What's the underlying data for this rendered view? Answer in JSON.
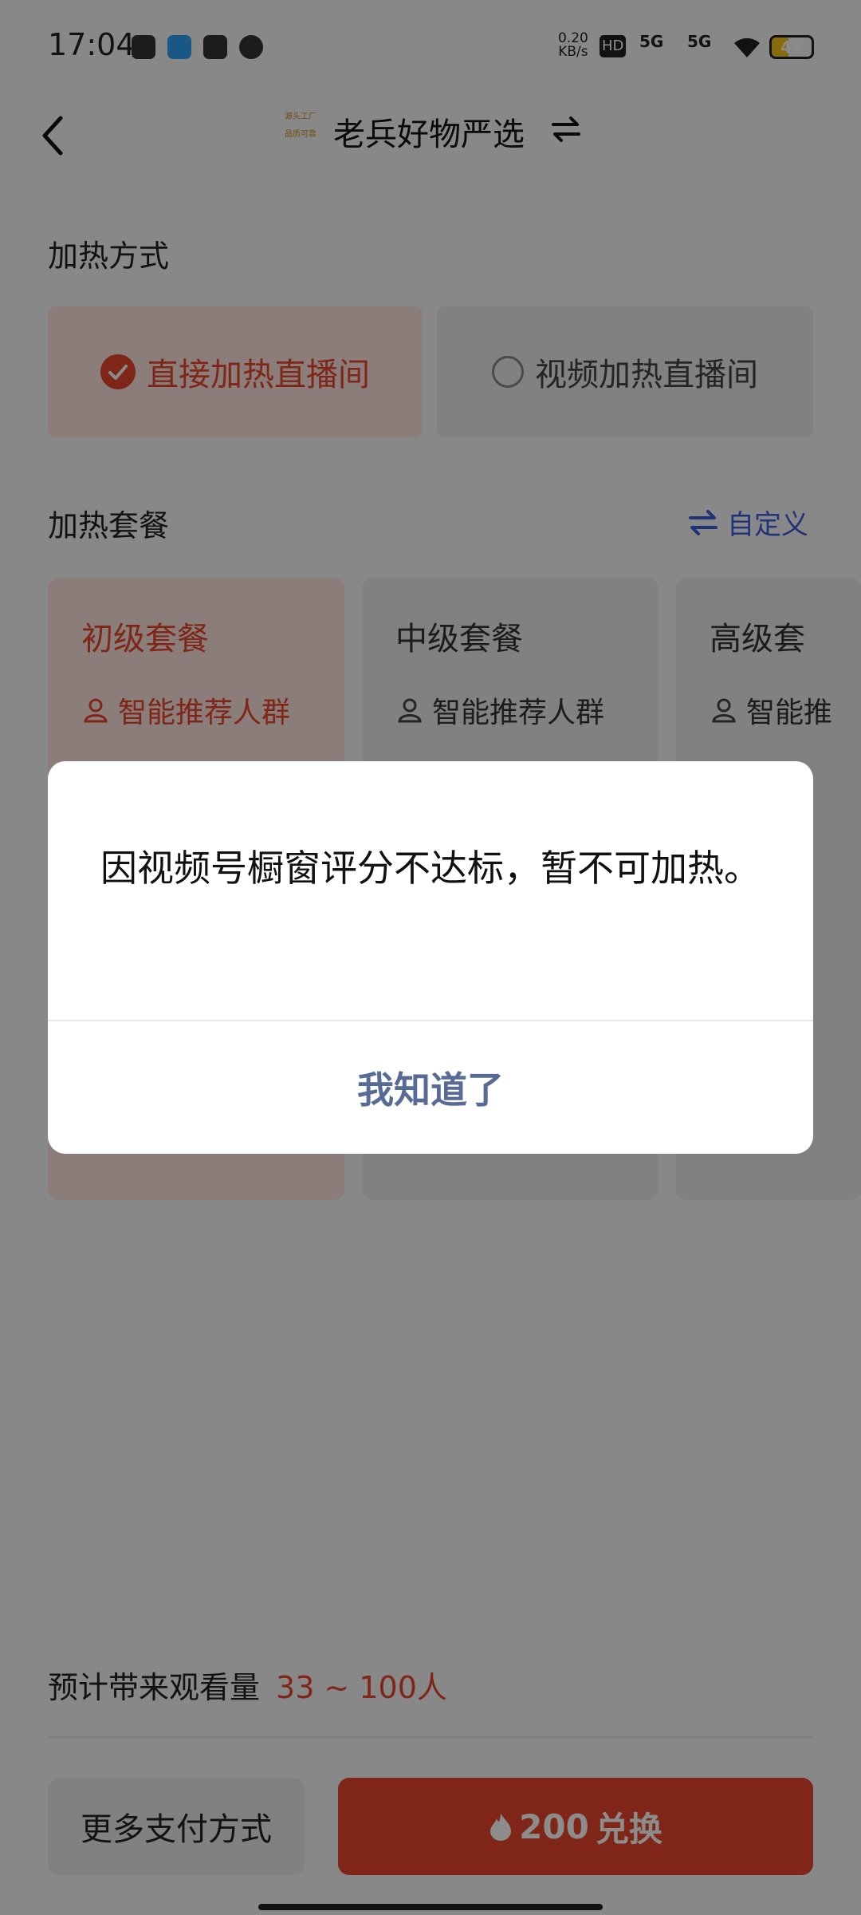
{
  "status_bar": {
    "time": "17:04",
    "net_speed_value": "0.20",
    "net_speed_unit": "KB/s",
    "hd_label": "HD",
    "sim1": "5G",
    "sim2": "5G",
    "battery": "41",
    "battery_level": 0.41
  },
  "header": {
    "logo_line1": "源头工厂",
    "logo_line2": "品质可靠",
    "shop_name": "老兵好物严选"
  },
  "heat_method": {
    "title": "加热方式",
    "options": [
      {
        "label": "直接加热直播间",
        "selected": true
      },
      {
        "label": "视频加热直播间",
        "selected": false
      }
    ]
  },
  "packages": {
    "title": "加热套餐",
    "custom_label": "自定义",
    "items": [
      {
        "name": "初级套餐",
        "feature": "智能推荐人群",
        "selected": true
      },
      {
        "name": "中级套餐",
        "feature": "智能推荐人群",
        "selected": false
      },
      {
        "name": "高级套",
        "feature": "智能推",
        "selected": false
      }
    ]
  },
  "estimate": {
    "label": "预计带来观看量",
    "value": "33 ~ 100人"
  },
  "footer": {
    "more_payment": "更多支付方式",
    "redeem_amount": "200",
    "redeem_label": "兑换"
  },
  "dialog": {
    "message": "因视频号橱窗评分不达标，暂不可加热。",
    "button": "我知道了"
  },
  "colors": {
    "accent": "#e8452c",
    "dialog_button": "#576b95"
  }
}
